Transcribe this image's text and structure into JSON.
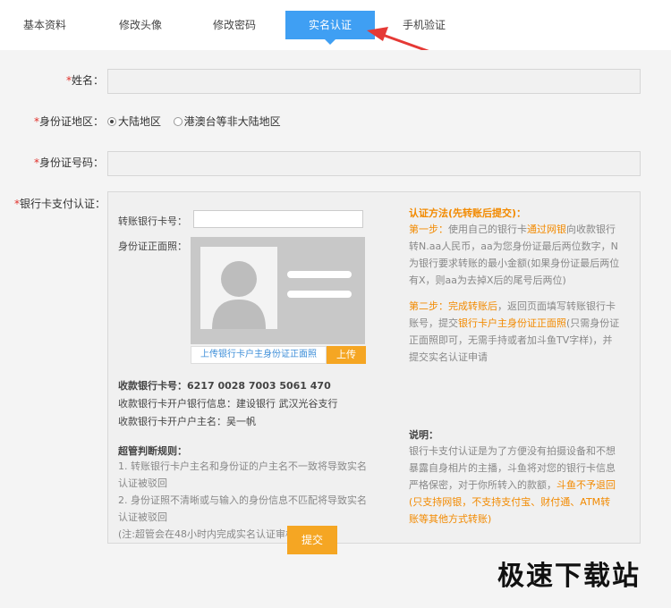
{
  "tabs": [
    {
      "label": "基本资料"
    },
    {
      "label": "修改头像"
    },
    {
      "label": "修改密码"
    },
    {
      "label": "实名认证"
    },
    {
      "label": "手机验证"
    }
  ],
  "form": {
    "name_label": "姓名：",
    "id_region_label": "身份证地区：",
    "region_options": [
      "大陆地区",
      "港澳台等非大陆地区"
    ],
    "id_number_label": "身份证号码：",
    "bank_auth_label": "银行卡支付认证："
  },
  "bank": {
    "transfer_card_label": "转账银行卡号：",
    "id_photo_label": "身份证正面照：",
    "upload_hint": "上传银行卡户主身份证正面照",
    "upload_button": "上传",
    "receiving_card": "收款银行卡号：6217 0028 7003 5061 470",
    "receiving_bank": "收款银行卡开户银行信息：建设银行 武汉光谷支行",
    "receiving_name": "收款银行卡开户户主名：吴一帆",
    "rules_title": "超管判断规则：",
    "rule1a": "1. 转账银行卡户主名和身份证的户主名不一致将导致实名",
    "rule1b": "认证被驳回",
    "rule2a": "2. 身份证照不清晰或与输入的身份信息不匹配将导致实名",
    "rule2b": "认证被驳回",
    "rule_note": "(注:超管会在48小时内完成实名认证审核)"
  },
  "method": {
    "title": "认证方法(先转账后提交)：",
    "s1_a": "第一步：",
    "s1_b": "使用自己的银行卡",
    "s1_c": "通过网银",
    "s1_d": "向收款银行",
    "s1_l2": "转N.aa人民币，aa为您身份证最后两位数字，N",
    "s1_l3": "为银行要求转账的最小金额(如果身份证最后两位",
    "s1_l4": "有X，则aa为去掉X后的尾号后两位)",
    "s2_a": "第二步：",
    "s2_b": "完成转账后",
    "s2_c": "，返回页面填写转账银行卡",
    "s2_l2a": "账号，提交",
    "s2_l2b": "银行卡户主身份证正面照",
    "s2_l2c": "(只需身份证",
    "s2_l3": "正面照即可，无需手持或者加斗鱼TV字样)，并",
    "s2_l4": "提交实名认证申请"
  },
  "note": {
    "title": "说明：",
    "l1": "银行卡支付认证是为了方便没有拍摄设备和不想",
    "l2": "暴露自身相片的主播，斗鱼将对您的银行卡信息",
    "l3a": "严格保密，对于你所转入的款额，",
    "l3b": "斗鱼不予退回",
    "l4": "(只支持网银，不支持支付宝、财付通、ATM转",
    "l5": "账等其他方式转账)"
  },
  "submit_label": "提交",
  "watermark": "极速下载站",
  "colors": {
    "accent": "#3f9ff3",
    "orange": "#f28a00",
    "button": "#f5a623",
    "required": "#e0312b"
  }
}
